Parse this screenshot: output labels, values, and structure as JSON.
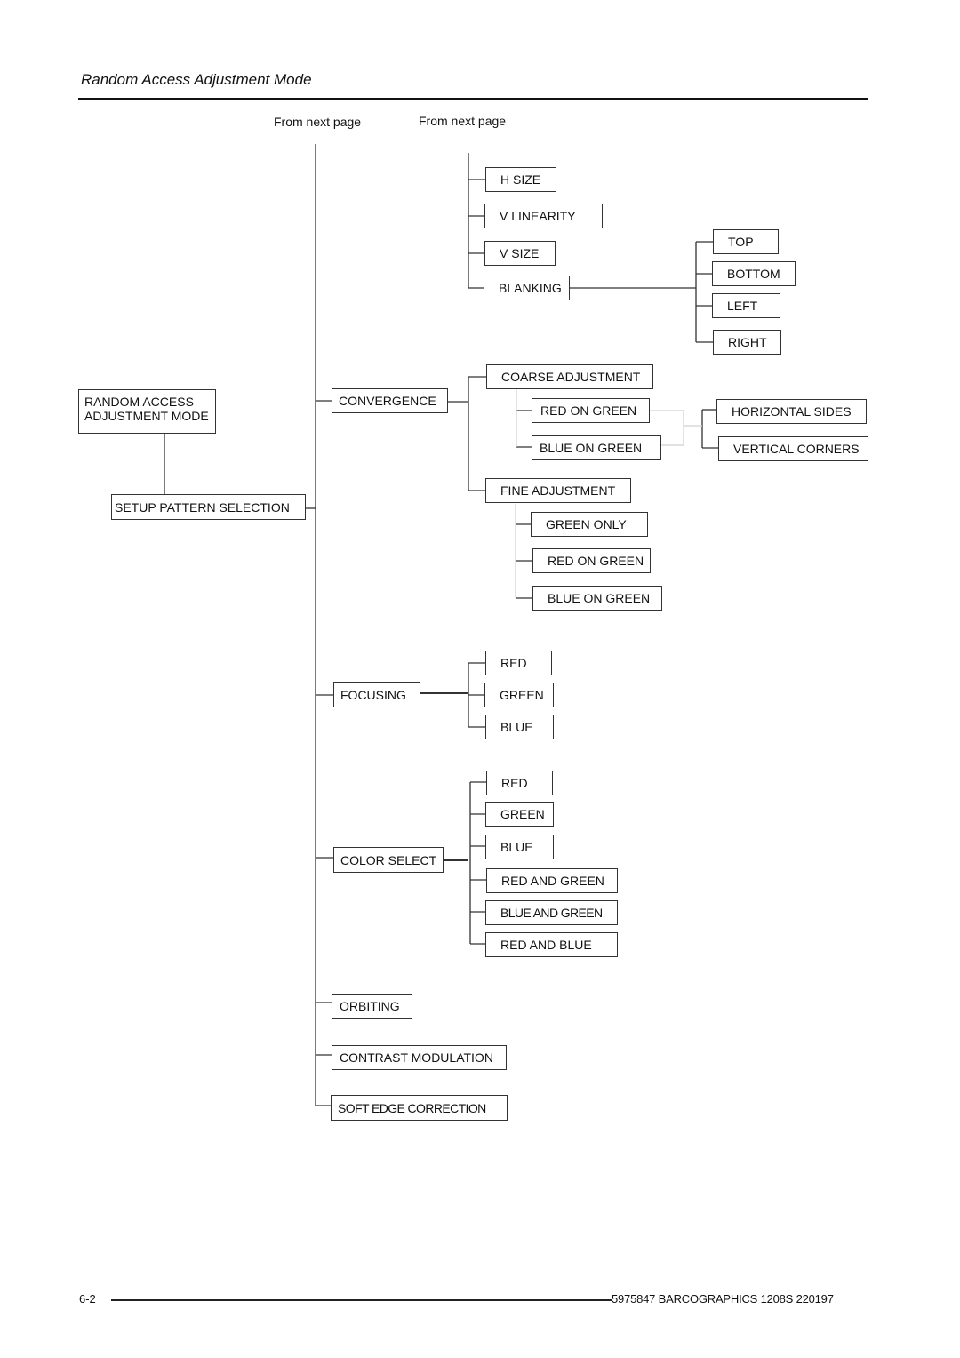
{
  "page": {
    "title": "Random Access Adjustment Mode",
    "from_next_page_left": "From next page",
    "from_next_page_right": "From next page",
    "footer": {
      "page_number": "6-2",
      "doc_id": "5975847 BARCOGRAPHICS 1208S 220197"
    }
  },
  "colors": {
    "line": "#333333",
    "line_light": "#d0d0d0",
    "box_border": "#333333",
    "text": "#111111"
  },
  "diagram": {
    "root": {
      "line1": "RANDOM  ACCESS",
      "line2": "ADJUSTMENT MODE"
    },
    "setup_pattern": "SETUP  PATTERN  SELECTION",
    "geometry": {
      "h_size": "H SIZE",
      "v_linearity": "V LINEARITY",
      "v_size": "V SIZE",
      "blanking": "BLANKING",
      "blanking_children": [
        "TOP",
        "BOTTOM",
        "LEFT",
        "RIGHT"
      ]
    },
    "convergence": {
      "label": "CONVERGENCE",
      "coarse": {
        "label": "COARSE  ADJUSTMENT",
        "children": [
          "RED ON GREEN",
          "BLUE ON GREEN"
        ],
        "sub_children": [
          "HORIZONTAL  SIDES",
          "VERTICAL  CORNERS"
        ]
      },
      "fine": {
        "label": "FINE  ADJUSTMENT",
        "children": [
          "GREEN ONLY",
          "RED ON GREEN",
          "BLUE ON GREEN"
        ]
      }
    },
    "focusing": {
      "label": "FOCUSING",
      "children": [
        "RED",
        "GREEN",
        "BLUE"
      ]
    },
    "color_select": {
      "label": "COLOR SELECT",
      "children": [
        "RED",
        "GREEN",
        "BLUE",
        "RED  AND  GREEN",
        "BLUE AND GREEN",
        "RED  AND  BLUE"
      ]
    },
    "orbiting": "ORBITING",
    "contrast_modulation": "CONTRAST  MODULATION",
    "soft_edge_correction": "SOFT EDGE CORRECTION"
  }
}
